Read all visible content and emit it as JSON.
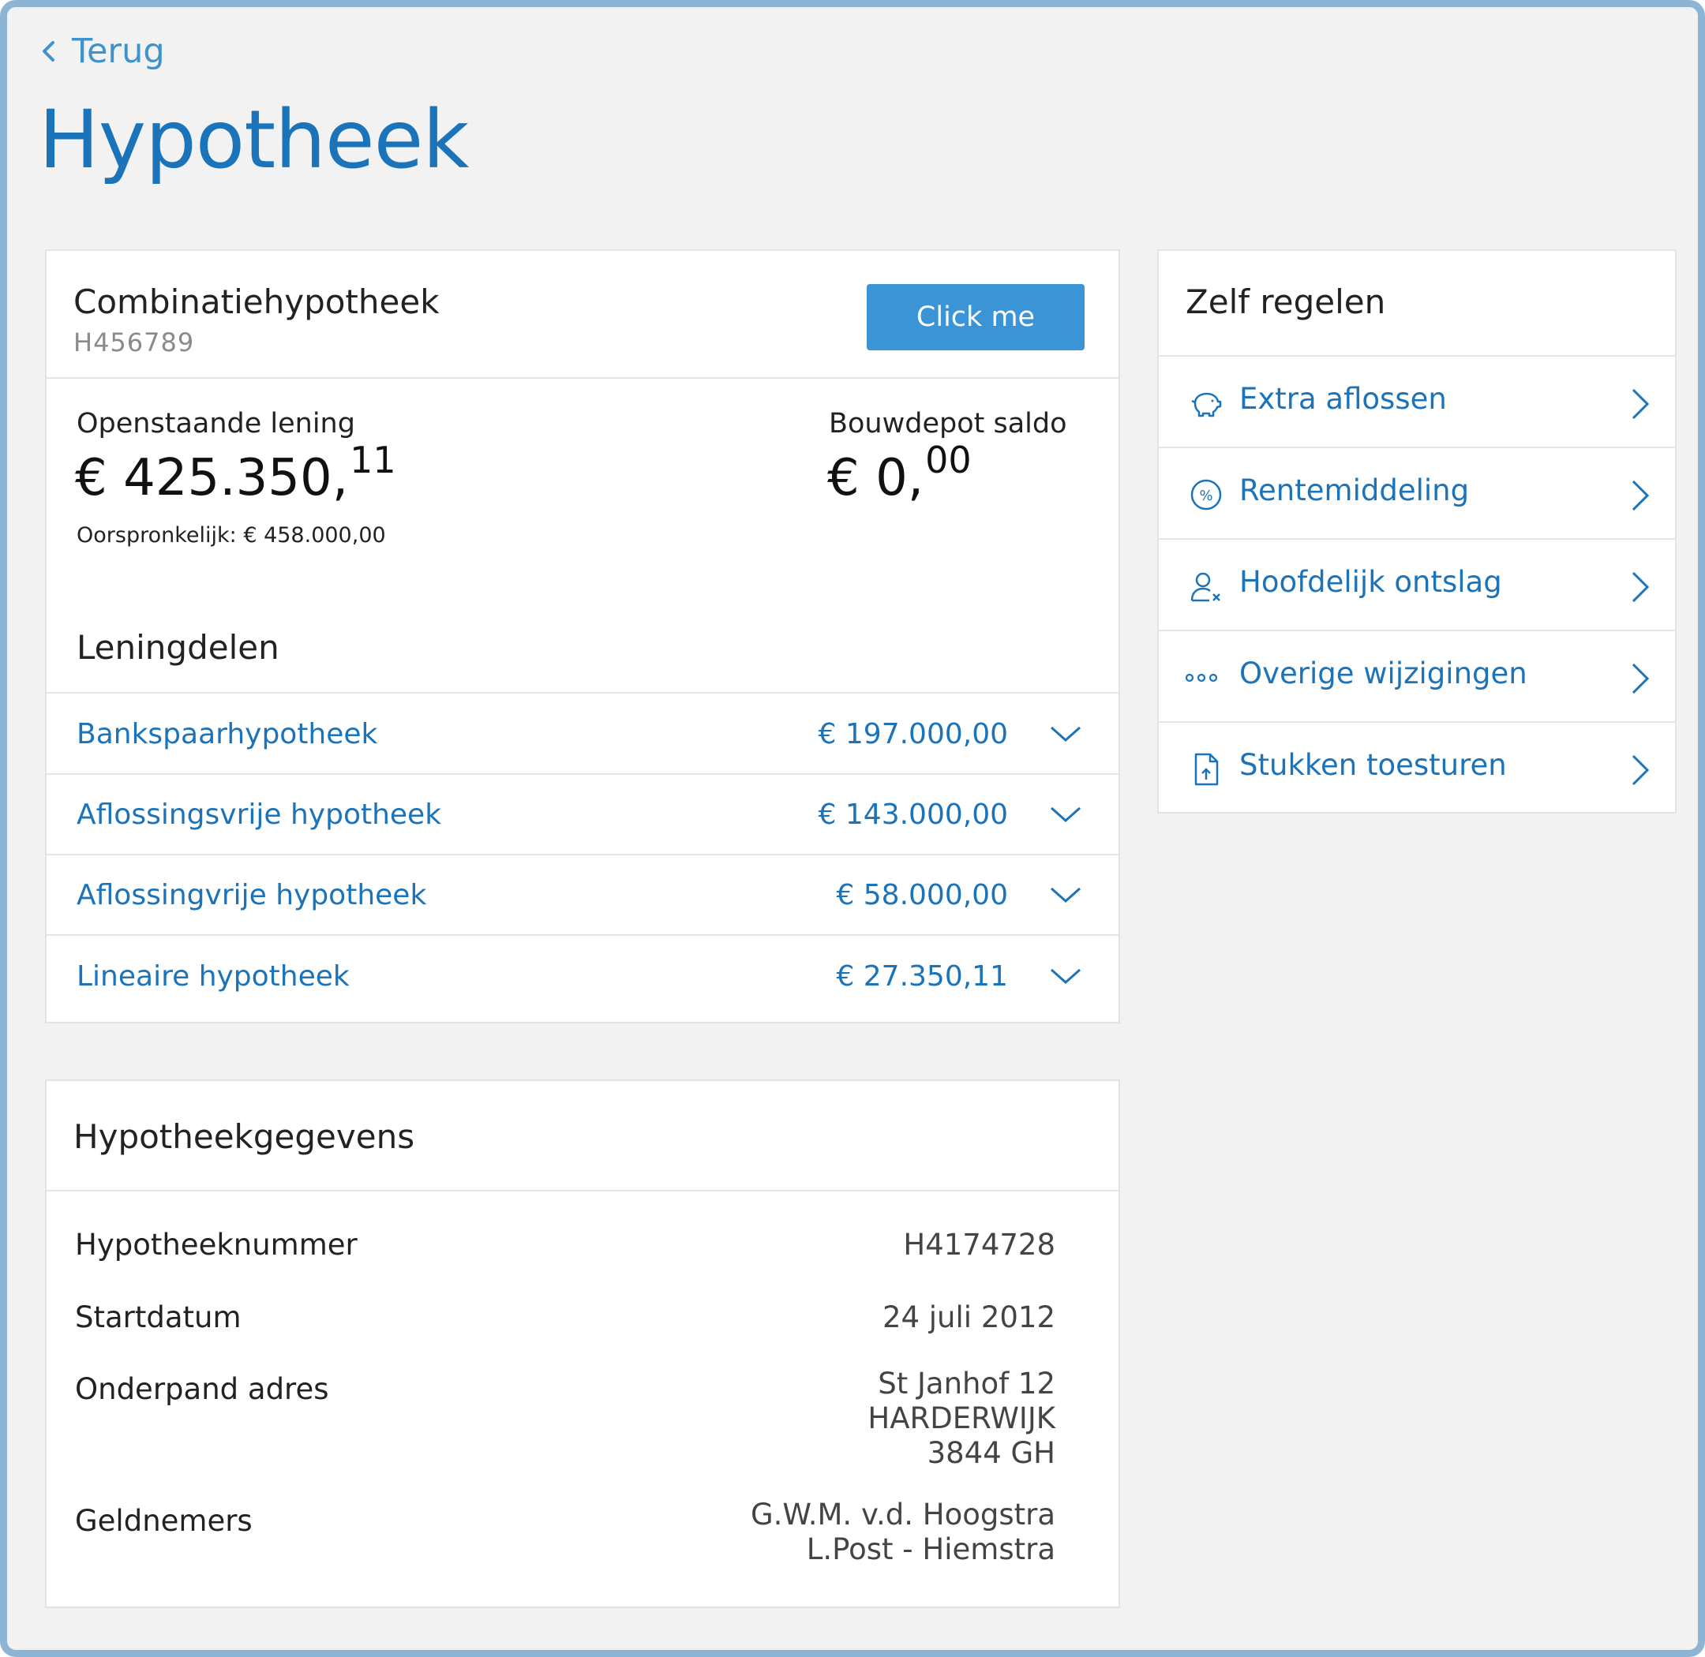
{
  "nav": {
    "back_label": "Terug"
  },
  "page": {
    "title": "Hypotheek"
  },
  "mortgage": {
    "title": "Combinatiehypotheek",
    "number": "H456789",
    "cta_label": "Click me",
    "outstanding": {
      "label": "Openstaande lening",
      "amount_main": "€ 425.350,",
      "amount_cents": "11",
      "original": "Oorspronkelijk: € 458.000,00"
    },
    "bouwdepot": {
      "label": "Bouwdepot saldo",
      "amount_main": "€ 0,",
      "amount_cents": "00"
    },
    "parts_title": "Leningdelen",
    "parts": [
      {
        "name": "Bankspaarhypotheek",
        "amount": "€ 197.000,00"
      },
      {
        "name": "Aflossingsvrije hypotheek",
        "amount": "€ 143.000,00"
      },
      {
        "name": "Aflossingvrije hypotheek",
        "amount": "€ 58.000,00"
      },
      {
        "name": "Lineaire hypotheek",
        "amount": "€ 27.350,11"
      }
    ]
  },
  "details": {
    "title": "Hypotheekgegevens",
    "rows": [
      {
        "label": "Hypotheeknummer",
        "lines": [
          "H4174728"
        ]
      },
      {
        "label": "Startdatum",
        "lines": [
          "24 juli 2012"
        ]
      },
      {
        "label": "Onderpand adres",
        "lines": [
          "St Janhof 12",
          "HARDERWIJK",
          "3844 GH"
        ]
      },
      {
        "label": "Geldnemers",
        "lines": [
          "G.W.M. v.d. Hoogstra",
          "L.Post - Hiemstra"
        ]
      }
    ]
  },
  "self_service": {
    "title": "Zelf regelen",
    "items": [
      {
        "label": "Extra aflossen",
        "icon": "piggy-bank-icon"
      },
      {
        "label": "Rentemiddeling",
        "icon": "percent-icon"
      },
      {
        "label": "Hoofdelijk ontslag",
        "icon": "user-remove-icon"
      },
      {
        "label": "Overige wijzigingen",
        "icon": "more-dots-icon"
      },
      {
        "label": "Stukken toesturen",
        "icon": "document-upload-icon"
      }
    ]
  },
  "colors": {
    "brand_blue": "#1b73b9",
    "button_blue": "#3a94d6",
    "background": "#f2f2f3",
    "frame_border": "#8cb4d4"
  }
}
